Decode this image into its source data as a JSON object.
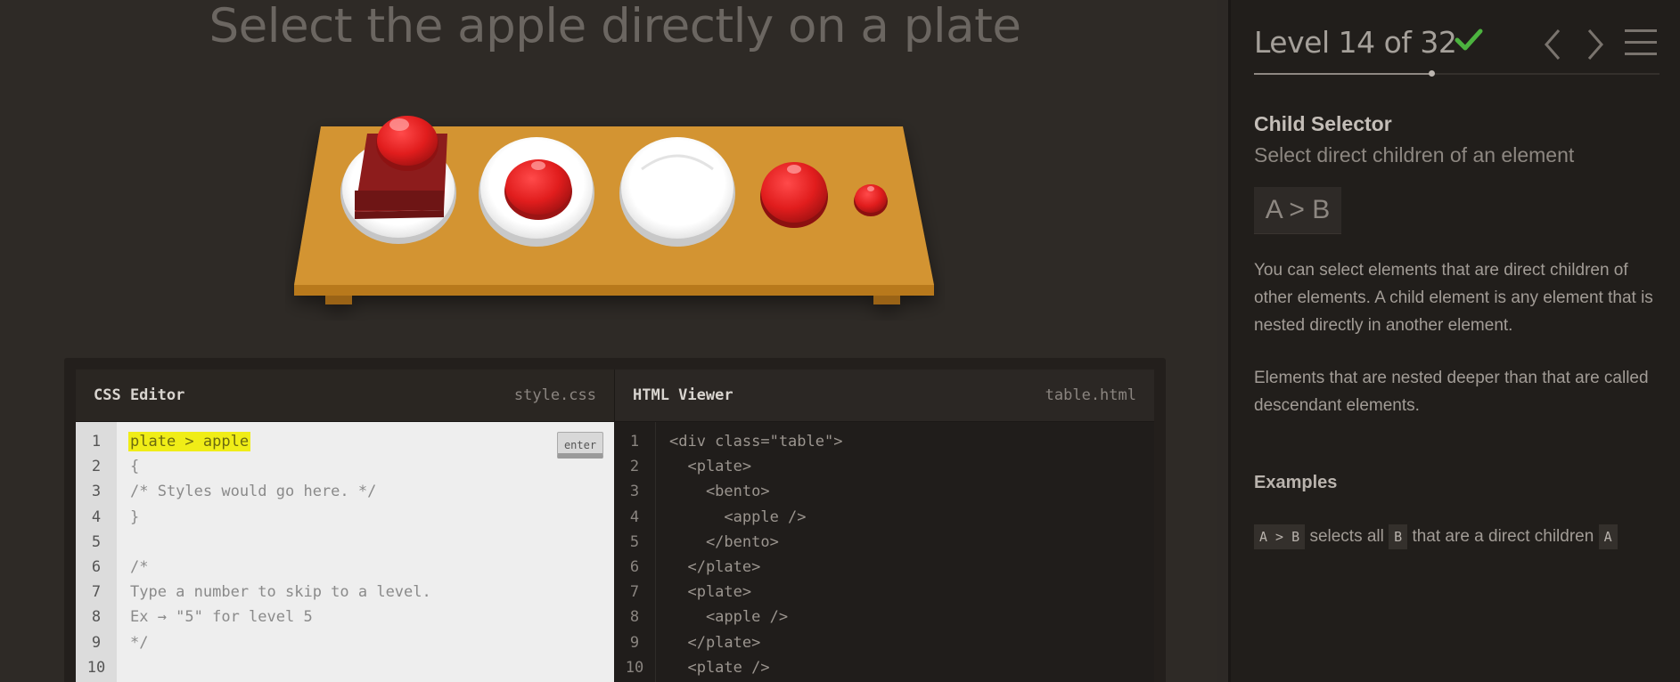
{
  "instructions": "Select the apple directly on a plate",
  "editor": {
    "css_title": "CSS Editor",
    "css_file": "style.css",
    "enter_label": "enter",
    "css_line_numbers": [
      "1",
      "2",
      "3",
      "4",
      "5",
      "6",
      "7",
      "8",
      "9",
      "10"
    ],
    "css_input": "plate > apple",
    "css_rest": "{\n/* Styles would go here. */\n}\n\n/*\nType a number to skip to a level.\nEx → \"5\" for level 5\n*/",
    "html_title": "HTML Viewer",
    "html_file": "table.html",
    "html_line_numbers": [
      "1",
      "2",
      "3",
      "4",
      "5",
      "6",
      "7",
      "8",
      "9",
      "10"
    ],
    "html_code": "<div class=\"table\">\n  <plate>\n    <bento>\n      <apple />\n    </bento>\n  </plate>\n  <plate>\n    <apple />\n  </plate>\n  <plate />"
  },
  "sidebar": {
    "level_text": "Level 14 of 32",
    "completed": true,
    "progress": 0.4375,
    "selector_name": "Child Selector",
    "selector_title": "Select direct children of an element",
    "syntax": "A > B",
    "hint_1": "You can select elements that are direct children of other elements. A child element is any element that is nested directly in another element.",
    "hint_2": "Elements that are nested deeper than that are called descendant elements.",
    "examples_label": "Examples",
    "example": {
      "tag": "A > B",
      "text_1": "selects all",
      "tag_b": "B",
      "text_2": "that are a direct children",
      "tag_a": "A"
    }
  },
  "colors": {
    "table_wood": "#c98a26",
    "apple_red": "#e11d1d",
    "bento_red": "#8d1c1c",
    "plate_white": "#ffffff",
    "check_green": "#4cb33f",
    "highlight_yellow": "#f0ed17"
  },
  "icons": [
    "check-icon",
    "chevron-left-icon",
    "chevron-right-icon",
    "hamburger-menu-icon"
  ]
}
